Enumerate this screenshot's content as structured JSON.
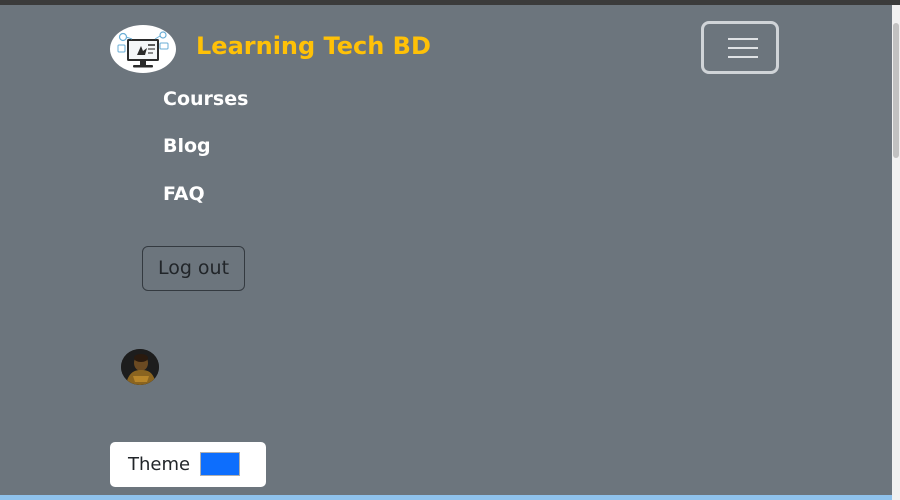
{
  "brand": {
    "title": "Learning Tech BD",
    "logo_icon": "computer-learning-logo",
    "title_color": "#ffc107"
  },
  "navbar": {
    "toggler_icon": "hamburger-menu-icon",
    "background_color": "#6c757d",
    "links": [
      {
        "label": "Courses"
      },
      {
        "label": "Blog"
      },
      {
        "label": "FAQ"
      }
    ]
  },
  "auth": {
    "logout_label": "Log out",
    "avatar_icon": "user-avatar"
  },
  "theme": {
    "label": "Theme",
    "swatch_color": "#0d6efd"
  }
}
